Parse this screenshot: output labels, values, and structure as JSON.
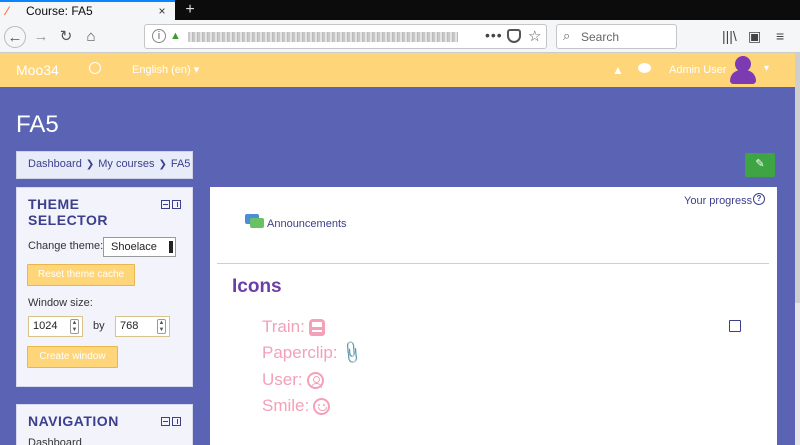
{
  "browser": {
    "tab_title": "Course: FA5",
    "tab_close": "×",
    "new_tab": "+",
    "search_placeholder": "Search",
    "url_menu": "•••"
  },
  "header": {
    "brand": "Moo34",
    "language": "English (en) ▾",
    "username": "Admin User",
    "user_caret": "▾"
  },
  "page": {
    "title": "FA5",
    "breadcrumb": [
      "Dashboard",
      "My courses",
      "FA5"
    ],
    "breadcrumb_sep": "❯",
    "edit_icon": "✎"
  },
  "theme_block": {
    "title_line1": "THEME",
    "title_line2": "SELECTOR",
    "change_theme_label": "Change theme:",
    "theme_value": "Shoelace",
    "reset_button": "Reset theme cache",
    "window_size_label": "Window size:",
    "width": "1024",
    "by_label": "by",
    "height": "768",
    "create_button": "Create window"
  },
  "nav_block": {
    "title": "NAVIGATION",
    "first_item": "Dashboard"
  },
  "main": {
    "progress_label": "Your progress",
    "help_glyph": "?",
    "announcements": "Announcements",
    "section_title": "Icons",
    "items": [
      {
        "label": "Train:",
        "icon": "train-icon"
      },
      {
        "label": "Paperclip:",
        "icon": "paperclip-icon"
      },
      {
        "label": "User:",
        "icon": "user-icon"
      },
      {
        "label": "Smile:",
        "icon": "smile-icon"
      }
    ],
    "paperclip_glyph": "📎"
  },
  "colors": {
    "page_bg": "#5b63b5",
    "header_bg": "#ffd57a",
    "accent": "#3b3f8c",
    "item_pink": "#f4a0b9",
    "section_purple": "#6b3fa6",
    "edit_green": "#3fa544"
  }
}
